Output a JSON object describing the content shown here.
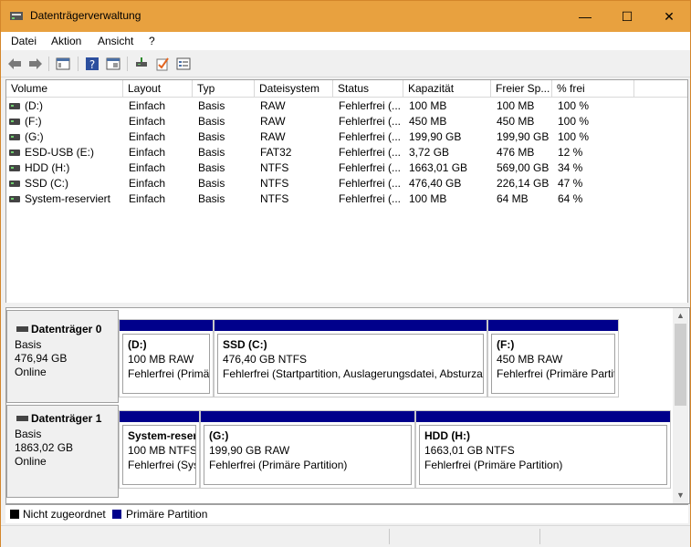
{
  "window": {
    "title": "Datenträgerverwaltung",
    "controls": {
      "minimize": "—",
      "maximize": "☐",
      "close": "✕"
    }
  },
  "menu": [
    "Datei",
    "Aktion",
    "Ansicht",
    "?"
  ],
  "toolbar": {
    "icons": [
      "back-icon",
      "forward-icon",
      "console-tree-icon",
      "help-icon",
      "properties-icon",
      "connect-disk-icon",
      "check-icon",
      "details-icon"
    ]
  },
  "volume_list": {
    "columns": [
      "Volume",
      "Layout",
      "Typ",
      "Dateisystem",
      "Status",
      "Kapazität",
      "Freier Sp...",
      "% frei"
    ],
    "rows": [
      [
        "(D:)",
        "Einfach",
        "Basis",
        "RAW",
        "Fehlerfrei (...",
        "100 MB",
        "100 MB",
        "100 %"
      ],
      [
        "(F:)",
        "Einfach",
        "Basis",
        "RAW",
        "Fehlerfrei (...",
        "450 MB",
        "450 MB",
        "100 %"
      ],
      [
        "(G:)",
        "Einfach",
        "Basis",
        "RAW",
        "Fehlerfrei (...",
        "199,90 GB",
        "199,90 GB",
        "100 %"
      ],
      [
        "ESD-USB (E:)",
        "Einfach",
        "Basis",
        "FAT32",
        "Fehlerfrei (...",
        "3,72 GB",
        "476 MB",
        "12 %"
      ],
      [
        "HDD (H:)",
        "Einfach",
        "Basis",
        "NTFS",
        "Fehlerfrei (...",
        "1663,01 GB",
        "569,00 GB",
        "34 %"
      ],
      [
        "SSD (C:)",
        "Einfach",
        "Basis",
        "NTFS",
        "Fehlerfrei (...",
        "476,40 GB",
        "226,14 GB",
        "47 %"
      ],
      [
        "System-reserviert",
        "Einfach",
        "Basis",
        "NTFS",
        "Fehlerfrei (...",
        "100 MB",
        "64 MB",
        "64 %"
      ]
    ]
  },
  "disks": [
    {
      "name": "Datenträger 0",
      "type": "Basis",
      "size": "476,94 GB",
      "status": "Online",
      "partitions": [
        {
          "name": "(D:)",
          "size": "100 MB RAW",
          "status": "Fehlerfrei (Primä"
        },
        {
          "name": "SSD  (C:)",
          "size": "476,40 GB NTFS",
          "status": "Fehlerfrei (Startpartition, Auslagerungsdatei, Absturzal"
        },
        {
          "name": "(F:)",
          "size": "450 MB RAW",
          "status": "Fehlerfrei (Primäre Partit"
        }
      ]
    },
    {
      "name": "Datenträger 1",
      "type": "Basis",
      "size": "1863,02 GB",
      "status": "Online",
      "partitions": [
        {
          "name": "System-reser",
          "size": "100 MB NTFS",
          "status": "Fehlerfrei (Sys"
        },
        {
          "name": "(G:)",
          "size": "199,90 GB RAW",
          "status": "Fehlerfrei (Primäre Partition)"
        },
        {
          "name": "HDD  (H:)",
          "size": "1663,01 GB NTFS",
          "status": "Fehlerfrei (Primäre Partition)"
        }
      ]
    }
  ],
  "legend": [
    {
      "label": "Nicht zugeordnet",
      "color": "#000000"
    },
    {
      "label": "Primäre Partition",
      "color": "#00008b"
    }
  ],
  "colors": {
    "titlebar": "#e8a13f",
    "primary_partition": "#00008b"
  }
}
